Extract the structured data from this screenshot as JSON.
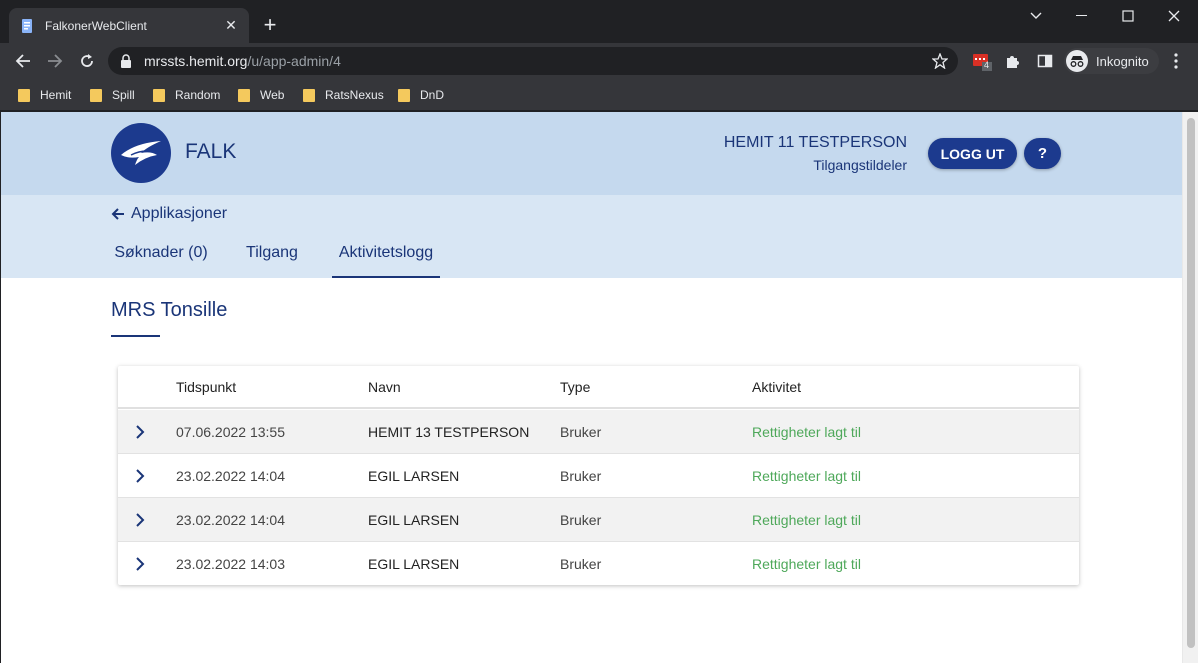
{
  "browser": {
    "tab_title": "FalkonerWebClient",
    "url_host": "mrssts.hemit.org",
    "url_path": "/u/app-admin/4",
    "extension_badge": "4",
    "profile_label": "Inkognito",
    "bookmarks": [
      "Hemit",
      "Spill",
      "Random",
      "Web",
      "RatsNexus",
      "DnD"
    ]
  },
  "header": {
    "brand": "FALK",
    "user_name": "HEMIT 11 TESTPERSON",
    "user_role": "Tilgangstildeler",
    "logout_label": "LOGG UT",
    "help_label": "?"
  },
  "subnav": {
    "back_label": "Applikasjoner",
    "tabs": [
      {
        "label": "Søknader (0)"
      },
      {
        "label": "Tilgang"
      },
      {
        "label": "Aktivitetslogg",
        "active": true
      }
    ]
  },
  "main": {
    "title": "MRS Tonsille",
    "table": {
      "columns": [
        "Tidspunkt",
        "Navn",
        "Type",
        "Aktivitet"
      ],
      "rows": [
        {
          "time": "07.06.2022 13:55",
          "name": "HEMIT 13 TESTPERSON",
          "type": "Bruker",
          "activity": "Rettigheter lagt til"
        },
        {
          "time": "23.02.2022 14:04",
          "name": "EGIL LARSEN",
          "type": "Bruker",
          "activity": "Rettigheter lagt til"
        },
        {
          "time": "23.02.2022 14:04",
          "name": "EGIL LARSEN",
          "type": "Bruker",
          "activity": "Rettigheter lagt til"
        },
        {
          "time": "23.02.2022 14:03",
          "name": "EGIL LARSEN",
          "type": "Bruker",
          "activity": "Rettigheter lagt til"
        }
      ]
    }
  },
  "colors": {
    "brand_blue": "#1c3a8e",
    "header_bg": "#c5d9ee",
    "subnav_bg": "#d8e6f4",
    "activity_green": "#4ea85a"
  }
}
